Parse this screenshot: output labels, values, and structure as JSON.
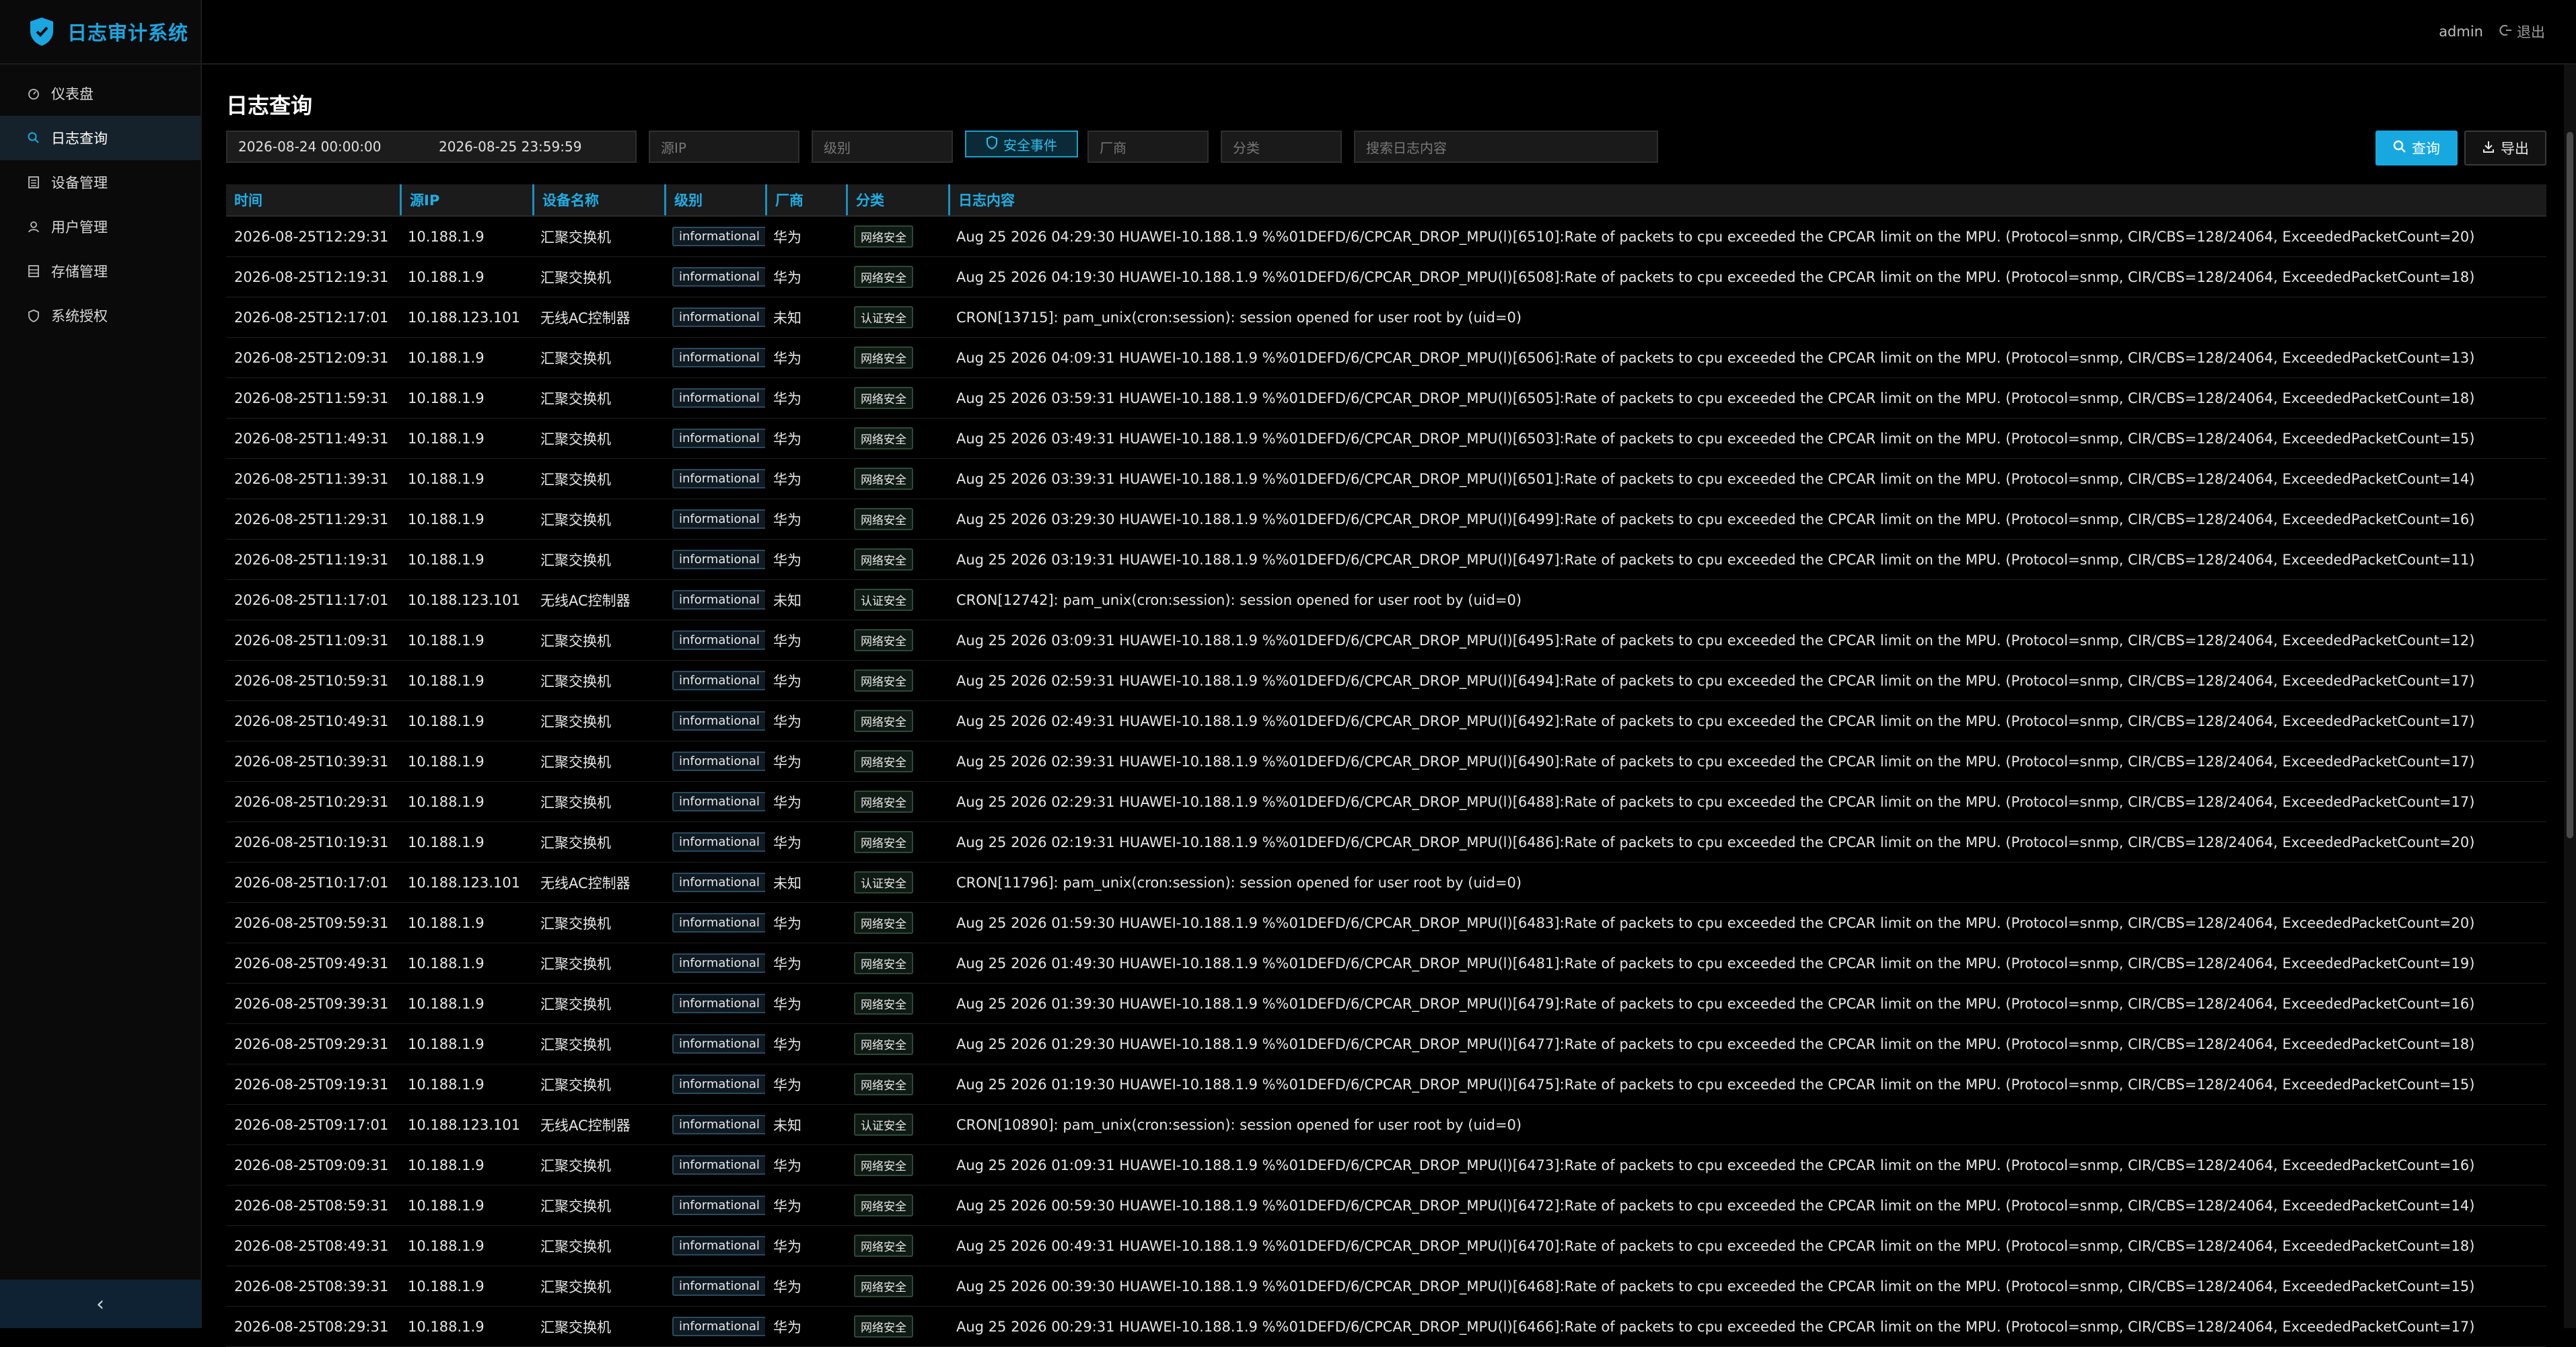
{
  "app": {
    "title": "日志审计系统"
  },
  "sidebar": {
    "items": [
      {
        "label": "仪表盘",
        "icon": "dashboard-icon"
      },
      {
        "label": "日志查询",
        "icon": "search-icon",
        "active": true
      },
      {
        "label": "设备管理",
        "icon": "device-list-icon"
      },
      {
        "label": "用户管理",
        "icon": "user-icon"
      },
      {
        "label": "存储管理",
        "icon": "storage-icon"
      },
      {
        "label": "系统授权",
        "icon": "shield-icon"
      }
    ],
    "collapse_label": "‹"
  },
  "header": {
    "user": "admin",
    "logout_label": "退出"
  },
  "page": {
    "title": "日志查询"
  },
  "filters": {
    "start_date": "2026-08-24 00:00:00",
    "end_date": "2026-08-25 23:59:59",
    "src_ip_placeholder": "源IP",
    "level_placeholder": "级别",
    "security_event_label": "安全事件",
    "vendor_placeholder": "厂商",
    "category_placeholder": "分类",
    "content_placeholder": "搜索日志内容",
    "query_label": "查询",
    "export_label": "导出"
  },
  "table": {
    "columns": [
      "时间",
      "源IP",
      "设备名称",
      "级别",
      "厂商",
      "分类",
      "日志内容"
    ],
    "rows": [
      [
        "2026-08-25T12:29:31",
        "10.188.1.9",
        "汇聚交换机",
        "informational",
        "华为",
        "网络安全",
        "Aug 25 2026 04:29:30 HUAWEI-10.188.1.9 %%01DEFD/6/CPCAR_DROP_MPU(l)[6510]:Rate of packets to cpu exceeded the CPCAR limit on the MPU. (Protocol=snmp, CIR/CBS=128/24064, ExceededPacketCount=20)"
      ],
      [
        "2026-08-25T12:19:31",
        "10.188.1.9",
        "汇聚交换机",
        "informational",
        "华为",
        "网络安全",
        "Aug 25 2026 04:19:30 HUAWEI-10.188.1.9 %%01DEFD/6/CPCAR_DROP_MPU(l)[6508]:Rate of packets to cpu exceeded the CPCAR limit on the MPU. (Protocol=snmp, CIR/CBS=128/24064, ExceededPacketCount=18)"
      ],
      [
        "2026-08-25T12:17:01",
        "10.188.123.101",
        "无线AC控制器",
        "informational",
        "未知",
        "认证安全",
        "CRON[13715]: pam_unix(cron:session): session opened for user root by (uid=0)"
      ],
      [
        "2026-08-25T12:09:31",
        "10.188.1.9",
        "汇聚交换机",
        "informational",
        "华为",
        "网络安全",
        "Aug 25 2026 04:09:31 HUAWEI-10.188.1.9 %%01DEFD/6/CPCAR_DROP_MPU(l)[6506]:Rate of packets to cpu exceeded the CPCAR limit on the MPU. (Protocol=snmp, CIR/CBS=128/24064, ExceededPacketCount=13)"
      ],
      [
        "2026-08-25T11:59:31",
        "10.188.1.9",
        "汇聚交换机",
        "informational",
        "华为",
        "网络安全",
        "Aug 25 2026 03:59:31 HUAWEI-10.188.1.9 %%01DEFD/6/CPCAR_DROP_MPU(l)[6505]:Rate of packets to cpu exceeded the CPCAR limit on the MPU. (Protocol=snmp, CIR/CBS=128/24064, ExceededPacketCount=18)"
      ],
      [
        "2026-08-25T11:49:31",
        "10.188.1.9",
        "汇聚交换机",
        "informational",
        "华为",
        "网络安全",
        "Aug 25 2026 03:49:31 HUAWEI-10.188.1.9 %%01DEFD/6/CPCAR_DROP_MPU(l)[6503]:Rate of packets to cpu exceeded the CPCAR limit on the MPU. (Protocol=snmp, CIR/CBS=128/24064, ExceededPacketCount=15)"
      ],
      [
        "2026-08-25T11:39:31",
        "10.188.1.9",
        "汇聚交换机",
        "informational",
        "华为",
        "网络安全",
        "Aug 25 2026 03:39:31 HUAWEI-10.188.1.9 %%01DEFD/6/CPCAR_DROP_MPU(l)[6501]:Rate of packets to cpu exceeded the CPCAR limit on the MPU. (Protocol=snmp, CIR/CBS=128/24064, ExceededPacketCount=14)"
      ],
      [
        "2026-08-25T11:29:31",
        "10.188.1.9",
        "汇聚交换机",
        "informational",
        "华为",
        "网络安全",
        "Aug 25 2026 03:29:30 HUAWEI-10.188.1.9 %%01DEFD/6/CPCAR_DROP_MPU(l)[6499]:Rate of packets to cpu exceeded the CPCAR limit on the MPU. (Protocol=snmp, CIR/CBS=128/24064, ExceededPacketCount=16)"
      ],
      [
        "2026-08-25T11:19:31",
        "10.188.1.9",
        "汇聚交换机",
        "informational",
        "华为",
        "网络安全",
        "Aug 25 2026 03:19:31 HUAWEI-10.188.1.9 %%01DEFD/6/CPCAR_DROP_MPU(l)[6497]:Rate of packets to cpu exceeded the CPCAR limit on the MPU. (Protocol=snmp, CIR/CBS=128/24064, ExceededPacketCount=11)"
      ],
      [
        "2026-08-25T11:17:01",
        "10.188.123.101",
        "无线AC控制器",
        "informational",
        "未知",
        "认证安全",
        "CRON[12742]: pam_unix(cron:session): session opened for user root by (uid=0)"
      ],
      [
        "2026-08-25T11:09:31",
        "10.188.1.9",
        "汇聚交换机",
        "informational",
        "华为",
        "网络安全",
        "Aug 25 2026 03:09:31 HUAWEI-10.188.1.9 %%01DEFD/6/CPCAR_DROP_MPU(l)[6495]:Rate of packets to cpu exceeded the CPCAR limit on the MPU. (Protocol=snmp, CIR/CBS=128/24064, ExceededPacketCount=12)"
      ],
      [
        "2026-08-25T10:59:31",
        "10.188.1.9",
        "汇聚交换机",
        "informational",
        "华为",
        "网络安全",
        "Aug 25 2026 02:59:31 HUAWEI-10.188.1.9 %%01DEFD/6/CPCAR_DROP_MPU(l)[6494]:Rate of packets to cpu exceeded the CPCAR limit on the MPU. (Protocol=snmp, CIR/CBS=128/24064, ExceededPacketCount=17)"
      ],
      [
        "2026-08-25T10:49:31",
        "10.188.1.9",
        "汇聚交换机",
        "informational",
        "华为",
        "网络安全",
        "Aug 25 2026 02:49:31 HUAWEI-10.188.1.9 %%01DEFD/6/CPCAR_DROP_MPU(l)[6492]:Rate of packets to cpu exceeded the CPCAR limit on the MPU. (Protocol=snmp, CIR/CBS=128/24064, ExceededPacketCount=17)"
      ],
      [
        "2026-08-25T10:39:31",
        "10.188.1.9",
        "汇聚交换机",
        "informational",
        "华为",
        "网络安全",
        "Aug 25 2026 02:39:31 HUAWEI-10.188.1.9 %%01DEFD/6/CPCAR_DROP_MPU(l)[6490]:Rate of packets to cpu exceeded the CPCAR limit on the MPU. (Protocol=snmp, CIR/CBS=128/24064, ExceededPacketCount=17)"
      ],
      [
        "2026-08-25T10:29:31",
        "10.188.1.9",
        "汇聚交换机",
        "informational",
        "华为",
        "网络安全",
        "Aug 25 2026 02:29:31 HUAWEI-10.188.1.9 %%01DEFD/6/CPCAR_DROP_MPU(l)[6488]:Rate of packets to cpu exceeded the CPCAR limit on the MPU. (Protocol=snmp, CIR/CBS=128/24064, ExceededPacketCount=17)"
      ],
      [
        "2026-08-25T10:19:31",
        "10.188.1.9",
        "汇聚交换机",
        "informational",
        "华为",
        "网络安全",
        "Aug 25 2026 02:19:31 HUAWEI-10.188.1.9 %%01DEFD/6/CPCAR_DROP_MPU(l)[6486]:Rate of packets to cpu exceeded the CPCAR limit on the MPU. (Protocol=snmp, CIR/CBS=128/24064, ExceededPacketCount=20)"
      ],
      [
        "2026-08-25T10:17:01",
        "10.188.123.101",
        "无线AC控制器",
        "informational",
        "未知",
        "认证安全",
        "CRON[11796]: pam_unix(cron:session): session opened for user root by (uid=0)"
      ],
      [
        "2026-08-25T09:59:31",
        "10.188.1.9",
        "汇聚交换机",
        "informational",
        "华为",
        "网络安全",
        "Aug 25 2026 01:59:30 HUAWEI-10.188.1.9 %%01DEFD/6/CPCAR_DROP_MPU(l)[6483]:Rate of packets to cpu exceeded the CPCAR limit on the MPU. (Protocol=snmp, CIR/CBS=128/24064, ExceededPacketCount=20)"
      ],
      [
        "2026-08-25T09:49:31",
        "10.188.1.9",
        "汇聚交换机",
        "informational",
        "华为",
        "网络安全",
        "Aug 25 2026 01:49:30 HUAWEI-10.188.1.9 %%01DEFD/6/CPCAR_DROP_MPU(l)[6481]:Rate of packets to cpu exceeded the CPCAR limit on the MPU. (Protocol=snmp, CIR/CBS=128/24064, ExceededPacketCount=19)"
      ],
      [
        "2026-08-25T09:39:31",
        "10.188.1.9",
        "汇聚交换机",
        "informational",
        "华为",
        "网络安全",
        "Aug 25 2026 01:39:30 HUAWEI-10.188.1.9 %%01DEFD/6/CPCAR_DROP_MPU(l)[6479]:Rate of packets to cpu exceeded the CPCAR limit on the MPU. (Protocol=snmp, CIR/CBS=128/24064, ExceededPacketCount=16)"
      ],
      [
        "2026-08-25T09:29:31",
        "10.188.1.9",
        "汇聚交换机",
        "informational",
        "华为",
        "网络安全",
        "Aug 25 2026 01:29:30 HUAWEI-10.188.1.9 %%01DEFD/6/CPCAR_DROP_MPU(l)[6477]:Rate of packets to cpu exceeded the CPCAR limit on the MPU. (Protocol=snmp, CIR/CBS=128/24064, ExceededPacketCount=18)"
      ],
      [
        "2026-08-25T09:19:31",
        "10.188.1.9",
        "汇聚交换机",
        "informational",
        "华为",
        "网络安全",
        "Aug 25 2026 01:19:30 HUAWEI-10.188.1.9 %%01DEFD/6/CPCAR_DROP_MPU(l)[6475]:Rate of packets to cpu exceeded the CPCAR limit on the MPU. (Protocol=snmp, CIR/CBS=128/24064, ExceededPacketCount=15)"
      ],
      [
        "2026-08-25T09:17:01",
        "10.188.123.101",
        "无线AC控制器",
        "informational",
        "未知",
        "认证安全",
        "CRON[10890]: pam_unix(cron:session): session opened for user root by (uid=0)"
      ],
      [
        "2026-08-25T09:09:31",
        "10.188.1.9",
        "汇聚交换机",
        "informational",
        "华为",
        "网络安全",
        "Aug 25 2026 01:09:31 HUAWEI-10.188.1.9 %%01DEFD/6/CPCAR_DROP_MPU(l)[6473]:Rate of packets to cpu exceeded the CPCAR limit on the MPU. (Protocol=snmp, CIR/CBS=128/24064, ExceededPacketCount=16)"
      ],
      [
        "2026-08-25T08:59:31",
        "10.188.1.9",
        "汇聚交换机",
        "informational",
        "华为",
        "网络安全",
        "Aug 25 2026 00:59:30 HUAWEI-10.188.1.9 %%01DEFD/6/CPCAR_DROP_MPU(l)[6472]:Rate of packets to cpu exceeded the CPCAR limit on the MPU. (Protocol=snmp, CIR/CBS=128/24064, ExceededPacketCount=14)"
      ],
      [
        "2026-08-25T08:49:31",
        "10.188.1.9",
        "汇聚交换机",
        "informational",
        "华为",
        "网络安全",
        "Aug 25 2026 00:49:31 HUAWEI-10.188.1.9 %%01DEFD/6/CPCAR_DROP_MPU(l)[6470]:Rate of packets to cpu exceeded the CPCAR limit on the MPU. (Protocol=snmp, CIR/CBS=128/24064, ExceededPacketCount=18)"
      ],
      [
        "2026-08-25T08:39:31",
        "10.188.1.9",
        "汇聚交换机",
        "informational",
        "华为",
        "网络安全",
        "Aug 25 2026 00:39:30 HUAWEI-10.188.1.9 %%01DEFD/6/CPCAR_DROP_MPU(l)[6468]:Rate of packets to cpu exceeded the CPCAR limit on the MPU. (Protocol=snmp, CIR/CBS=128/24064, ExceededPacketCount=15)"
      ],
      [
        "2026-08-25T08:29:31",
        "10.188.1.9",
        "汇聚交换机",
        "informational",
        "华为",
        "网络安全",
        "Aug 25 2026 00:29:31 HUAWEI-10.188.1.9 %%01DEFD/6/CPCAR_DROP_MPU(l)[6466]:Rate of packets to cpu exceeded the CPCAR limit on the MPU. (Protocol=snmp, CIR/CBS=128/24064, ExceededPacketCount=17)"
      ]
    ]
  },
  "colors": {
    "accent": "#1aa6e0",
    "background": "#000000",
    "sidebar": "#0a0a0a"
  }
}
